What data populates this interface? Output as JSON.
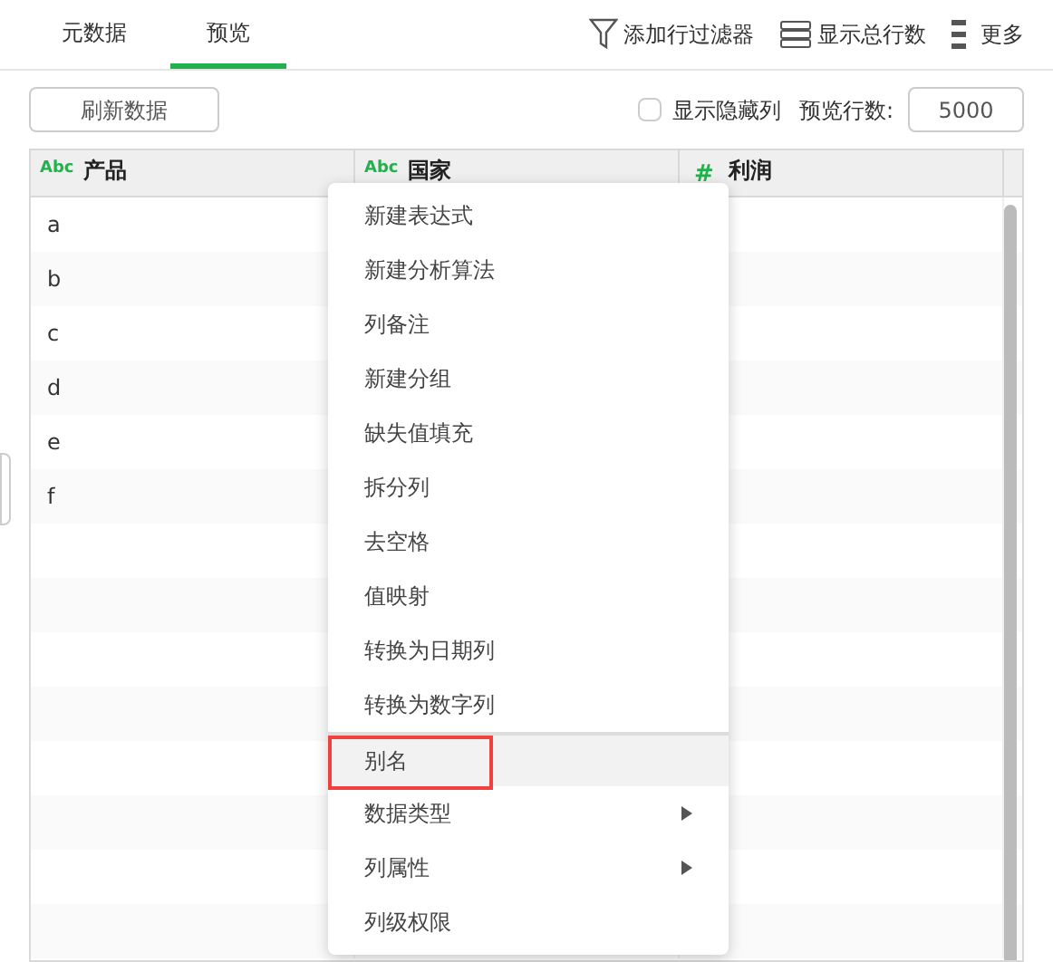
{
  "tabs": [
    {
      "label": "元数据",
      "selected": false
    },
    {
      "label": "预览",
      "selected": true
    }
  ],
  "toolbar": [
    {
      "kind": "filter",
      "label": "添加行过滤器"
    },
    {
      "kind": "rows",
      "label": "显示总行数"
    },
    {
      "kind": "more",
      "label": "更多"
    }
  ],
  "refresh_button": "刷新数据",
  "show_hidden_columns": {
    "label": "显示隐藏列",
    "checked": false
  },
  "preview_rows": {
    "label": "预览行数:",
    "value": "5000"
  },
  "table": {
    "columns": [
      {
        "type_icon": "Abc",
        "label": "产品"
      },
      {
        "type_icon": "Abc",
        "label": "国家"
      },
      {
        "type_icon": "#",
        "label": "利润"
      }
    ],
    "rows": [
      [
        "a",
        "",
        ""
      ],
      [
        "b",
        "",
        ""
      ],
      [
        "c",
        "",
        ""
      ],
      [
        "d",
        "",
        ""
      ],
      [
        "e",
        "",
        ""
      ],
      [
        "f",
        "",
        ""
      ]
    ]
  },
  "context_menu": [
    {
      "label": "新建表达式",
      "selected": false,
      "divider_before": false,
      "has_submenu": false,
      "outlined": false
    },
    {
      "label": "新建分析算法",
      "selected": false,
      "divider_before": false,
      "has_submenu": false,
      "outlined": false
    },
    {
      "label": "列备注",
      "selected": false,
      "divider_before": false,
      "has_submenu": false,
      "outlined": false
    },
    {
      "label": "新建分组",
      "selected": false,
      "divider_before": false,
      "has_submenu": false,
      "outlined": false
    },
    {
      "label": "缺失值填充",
      "selected": false,
      "divider_before": false,
      "has_submenu": false,
      "outlined": false
    },
    {
      "label": "拆分列",
      "selected": false,
      "divider_before": false,
      "has_submenu": false,
      "outlined": false
    },
    {
      "label": "去空格",
      "selected": false,
      "divider_before": false,
      "has_submenu": false,
      "outlined": false
    },
    {
      "label": "值映射",
      "selected": false,
      "divider_before": false,
      "has_submenu": false,
      "outlined": false
    },
    {
      "label": "转换为日期列",
      "selected": false,
      "divider_before": false,
      "has_submenu": false,
      "outlined": false
    },
    {
      "label": "转换为数字列",
      "selected": false,
      "divider_before": false,
      "has_submenu": false,
      "outlined": false
    },
    {
      "label": "别名",
      "selected": true,
      "divider_before": true,
      "has_submenu": false,
      "outlined": true
    },
    {
      "label": "数据类型",
      "selected": false,
      "divider_before": false,
      "has_submenu": true,
      "outlined": false
    },
    {
      "label": "列属性",
      "selected": false,
      "divider_before": false,
      "has_submenu": true,
      "outlined": false
    },
    {
      "label": "列级权限",
      "selected": false,
      "divider_before": false,
      "has_submenu": false,
      "outlined": false
    }
  ]
}
